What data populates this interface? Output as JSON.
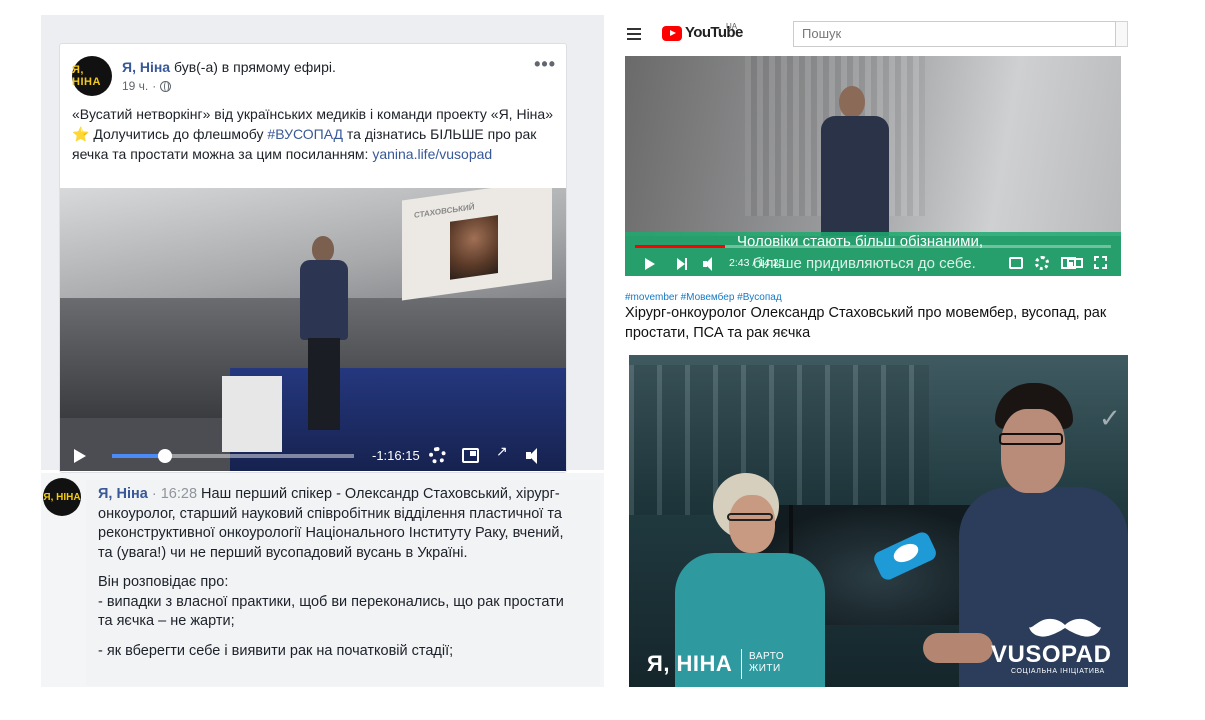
{
  "facebook_post": {
    "author": "Я, Ніна",
    "action": " був(-а) в прямому ефирі.",
    "age": "19 ч.",
    "separator": "·",
    "more": "•••",
    "avatar_text": "Я, НІНА",
    "text_line1": "«Вусатий нетворкінг» від українських медиків і команди проекту «Я, Ніна»",
    "star": "⭐",
    "text_line2_pre": " Долучитись до флешмобу ",
    "hashtag": "#ВУСОПАД",
    "text_line2_post": " та дізнатись БІЛЬШЕ про рак яечка та простати можна за цим посиланням: ",
    "link": "yanina.life/vusopad",
    "video": {
      "slide_title": "СТАХОВСЬКИЙ",
      "time_remaining": "-1:16:15",
      "progress": 0.22
    }
  },
  "facebook_comment": {
    "author": "Я, Ніна",
    "dot": "·",
    "time": "16:28",
    "avatar_text": "Я, НІНА",
    "para1": " Наш перший спікер - Олександр Стаховський, хірург-онкоуролог, старший науковий співробітник відділення пластичної та реконструктивної онкоурології Національного Інституту Раку, вчений, та (увага!) чи не перший вусопадовий вусань в Україні.",
    "para2_title": "Він розповідає про:",
    "para2_item1": "- випадки з власної практики, щоб ви переконались, що рак простати та яєчка – не жарти;",
    "para3": "- як вберегти себе і виявити рак на початковій стадії;"
  },
  "youtube": {
    "logo_text": "YouTube",
    "region": "UA",
    "search_placeholder": "Пошук",
    "caption_line1": "Чоловіки стають більш обізнаними,",
    "caption_line2": "більше придивляються до себе.",
    "time_current": "2:43",
    "time_separator": " / ",
    "time_total": "14:25",
    "progress": 0.19,
    "tags": "#movember #Мовембер #Вусопад",
    "title": "Хірург-онкоуролог Олександр Стаховський про мовембер, вусопад, рак простати, ПСА та рак яєчка"
  },
  "photo": {
    "logo_left": "Я, НІНА",
    "varto": "ВАРТО",
    "zhyty": "ЖИТИ",
    "logo_right": "VUSOPAD",
    "tagline": "СОЦІАЛЬНА ІНІЦІАТИВА"
  }
}
